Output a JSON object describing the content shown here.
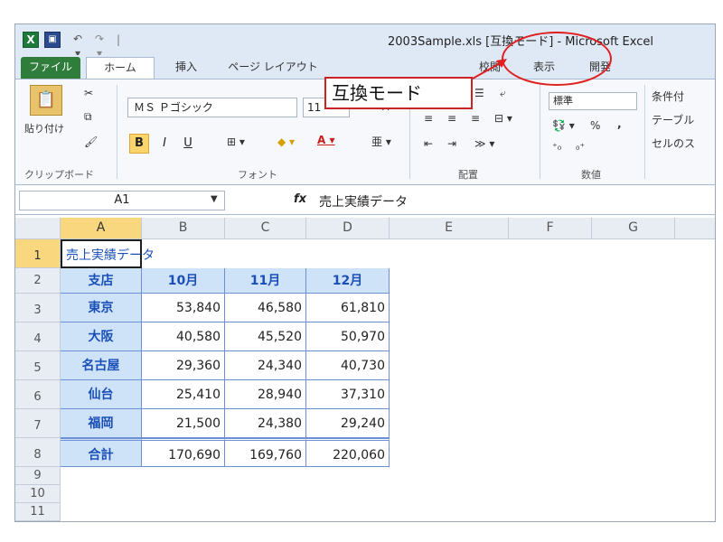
{
  "window": {
    "title": "2003Sample.xls [互換モード] - Microsoft Excel",
    "qat": {
      "logo": "X",
      "sep": "|",
      "undo": "↶ ▾",
      "redo": "↷ ▾"
    }
  },
  "tabs": [
    {
      "label": "ファイル"
    },
    {
      "label": "ホーム"
    },
    {
      "label": "挿入"
    },
    {
      "label": "ページ レイアウト"
    },
    {
      "label": "校閲"
    },
    {
      "label": "表示"
    },
    {
      "label": "開発"
    }
  ],
  "ribbon": {
    "clipboard": {
      "paste_label": "貼り付け",
      "group_label": "クリップボード"
    },
    "font": {
      "font_name": "ＭＳ Ｐゴシック",
      "font_size": "11",
      "bold": "B",
      "italic": "I",
      "underline": "U",
      "group_label": "フォント"
    },
    "alignment": {
      "group_label": "配置"
    },
    "number": {
      "format": "標準",
      "percent": "%",
      "comma": ",",
      "group_label": "数値"
    },
    "styles": {
      "conditional": "条件付",
      "table": "テーブル",
      "cell": "セルのス"
    }
  },
  "formula_bar": {
    "name_box": "A1",
    "fx": "fx",
    "content": "売上実績データ"
  },
  "grid": {
    "columns": [
      "A",
      "B",
      "C",
      "D",
      "E",
      "F",
      "G"
    ],
    "rows": [
      "1",
      "2",
      "3",
      "4",
      "5",
      "6",
      "7",
      "8",
      "9",
      "10",
      "11"
    ],
    "title_cell": "売上実績データ",
    "table_header": [
      "支店",
      "10月",
      "11月",
      "12月"
    ],
    "table_rows": [
      {
        "branch": "東京",
        "values": [
          "53,840",
          "46,580",
          "61,810"
        ]
      },
      {
        "branch": "大阪",
        "values": [
          "40,580",
          "45,520",
          "50,970"
        ]
      },
      {
        "branch": "名古屋",
        "values": [
          "29,360",
          "24,340",
          "40,730"
        ]
      },
      {
        "branch": "仙台",
        "values": [
          "25,410",
          "28,940",
          "37,310"
        ]
      },
      {
        "branch": "福岡",
        "values": [
          "21,500",
          "24,380",
          "29,240"
        ]
      }
    ],
    "total_row": {
      "branch": "合計",
      "values": [
        "170,690",
        "169,760",
        "220,060"
      ]
    }
  },
  "annotation": {
    "callout_text": "互換モード"
  },
  "colors": {
    "accent": "#1a4fb8",
    "table_fill": "#cfe3f8",
    "annotation": "#e02020",
    "file_tab": "#2e7d3a"
  }
}
